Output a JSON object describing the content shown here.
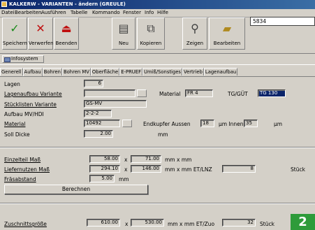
{
  "window": {
    "title": "KALKERW - VARIANTEN - ändern (GREULE)"
  },
  "menu": [
    "Datei",
    "Bearbeiten",
    "Ausführen",
    "Tabelle",
    "Kommando",
    "Fenster",
    "Info",
    "Hilfe"
  ],
  "toolbar": {
    "speichern": "Speichern",
    "verwerfen": "Verwerfen",
    "beenden": "Beenden",
    "neu": "Neu",
    "kopieren": "Kopieren",
    "zeigen": "Zeigen",
    "bearbeiten": "Bearbeiten",
    "combo_value": "5834"
  },
  "infosystem": "Infosystem",
  "tabs": [
    "Generell",
    "Aufbau",
    "Bohren",
    "Bohren MV",
    "Oberfläche",
    "E-PRUEF",
    "Umiß/Sonstiges",
    "Vertrieb",
    "Lagenaufbau"
  ],
  "form": {
    "lagen_label": "Lagen",
    "lagen_value": "6",
    "lagenaufbau_label": "Lagenaufbau Variante",
    "material_label2": "Material",
    "material_value2": "FR 4",
    "tg_label": "TG/GÜT",
    "tg_value": "TG 130",
    "stueckliste_label": "Stücklisten Variante",
    "stueckliste_value": "GS-MV",
    "aufbau_label": "Aufbau MV/HDI",
    "aufbau_value": "2-2-2",
    "material_label": "Material",
    "material_value": "10492",
    "endkupfer_label": "Endkupfer Aussen",
    "endkupfer_value": "18",
    "um_innen_label": "µm Innen",
    "innen_value": "35",
    "um_label": "µm",
    "solldicke_label": "Soll Dicke",
    "solldicke_value": "2.00",
    "mm_label": "mm",
    "einzelteil_label": "Einzelteil Maß",
    "einzelteil_x": "58.00",
    "x1": "x",
    "einzelteil_y": "71.00",
    "einzelteil_unit": "mm x mm",
    "liefernutzen_label": "Liefernutzen Maß",
    "liefernutzen_x": "294.10",
    "x2": "x",
    "liefernutzen_y": "146.00",
    "liefernutzen_unit": "mm x mm ET/LNZ",
    "liefernutzen_count": "8",
    "stueck1": "Stück",
    "fraesabstand_label": "Fräsabstand",
    "fraesabstand_value": "5.00",
    "fraesabstand_unit": "mm",
    "berechnen": "Berechnen",
    "zuschnitt_label": "Zuschnittsgröße",
    "zuschnitt_x": "610.00",
    "x3": "x",
    "zuschnitt_y": "530.00",
    "zuschnitt_unit": "mm x mm ET/Zuo",
    "zuschnitt_count": "32",
    "stueck2": "Stück"
  },
  "badge": "2",
  "colors": {
    "titlebar": "#0a246a",
    "badge": "#2e9b3a"
  }
}
